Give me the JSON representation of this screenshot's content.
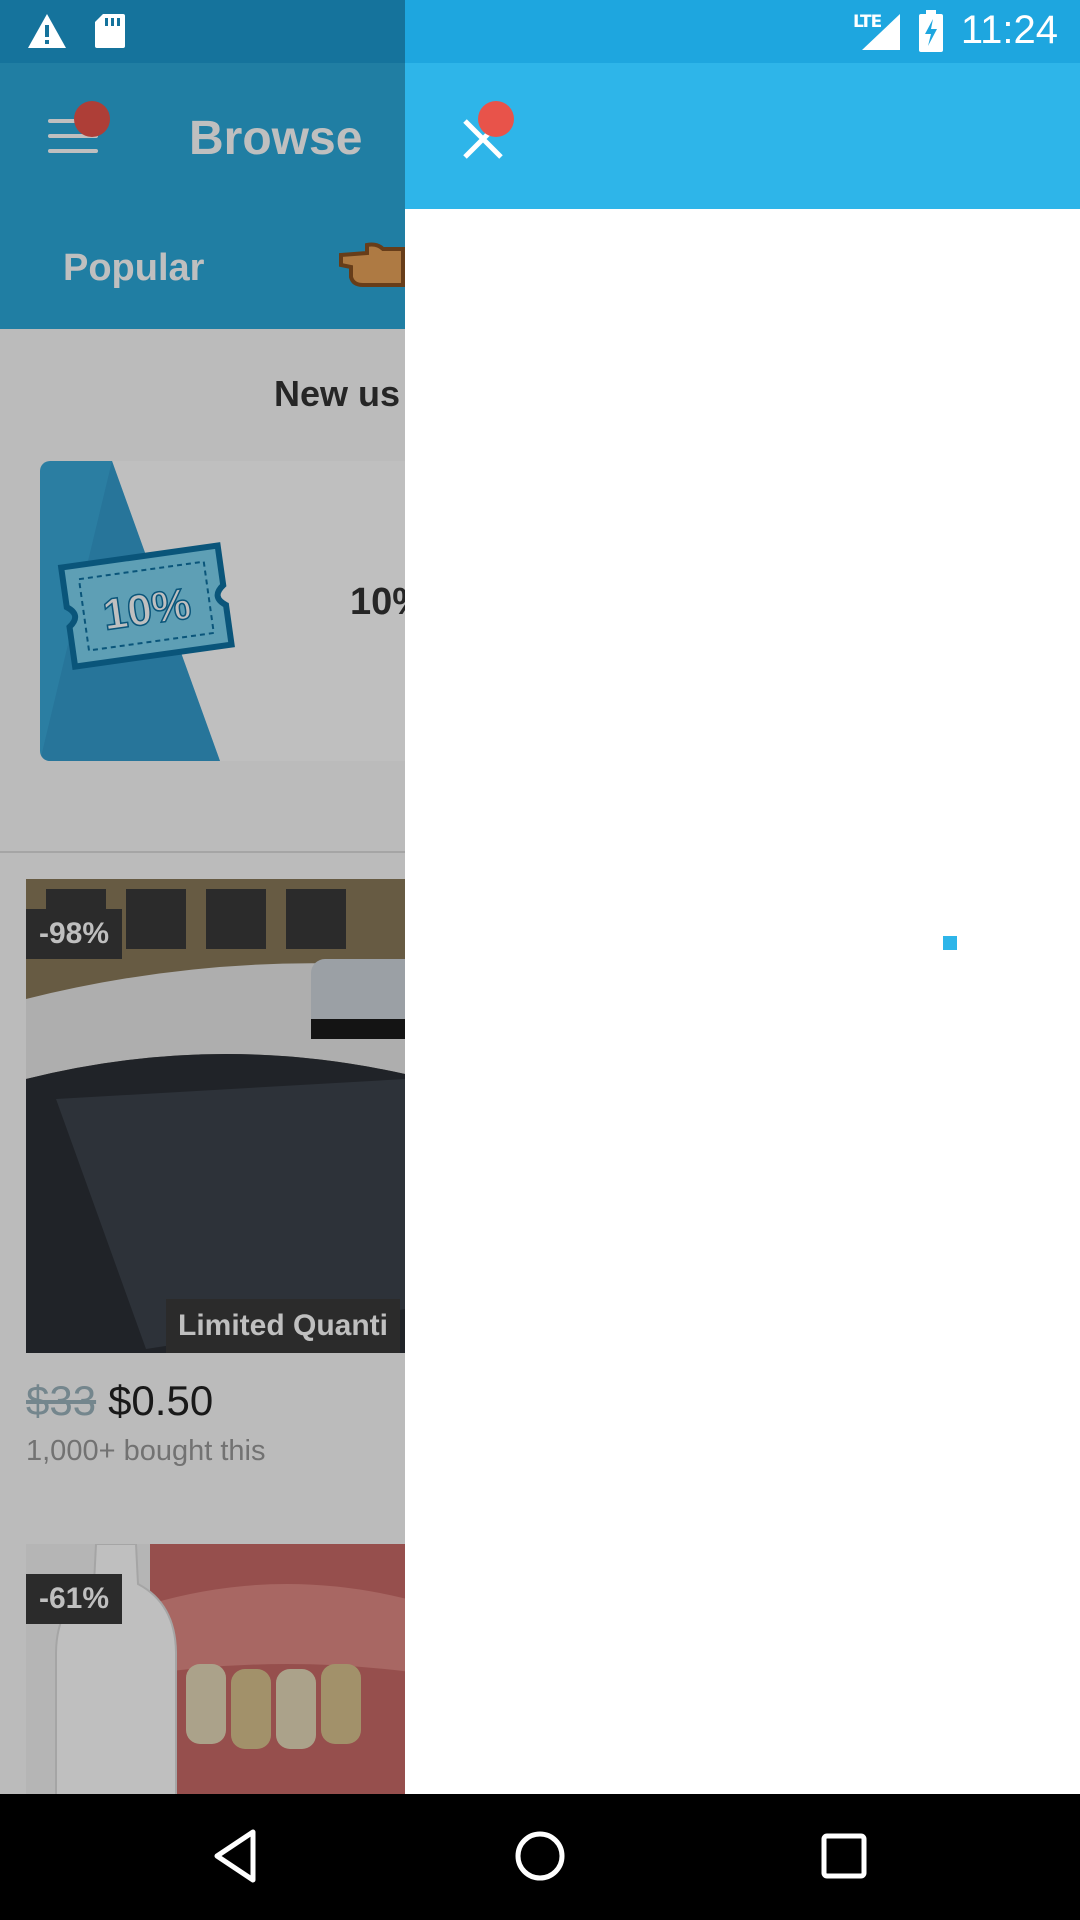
{
  "status_bar": {
    "time": "11:24",
    "network": "LTE",
    "icons": [
      "warning-icon",
      "sd-card-icon",
      "signal-icon",
      "battery-charging-icon"
    ]
  },
  "background_app": {
    "title": "Browse",
    "tabs": [
      {
        "label": "Popular"
      }
    ],
    "new_user_heading": "New us",
    "coupon": {
      "badge_text": "10%",
      "text": "10%"
    },
    "deals": [
      {
        "discount": "-98%",
        "badge": "Limited Quanti",
        "old_price": "$33",
        "price": "$0.50",
        "bought": "1,000+ bought this"
      },
      {
        "discount": "-61%"
      }
    ]
  },
  "drawer": {
    "close_icon": "close-icon"
  },
  "colors": {
    "primary": "#2BA8DA",
    "drawer_header": "#2EB5E9",
    "status_bar": "#1EA6DF",
    "notification_dot": "#E8534A",
    "badge_bg": "#3a3a3a"
  },
  "nav_bar": {
    "icons": [
      "back-icon",
      "home-icon",
      "recents-icon"
    ]
  }
}
